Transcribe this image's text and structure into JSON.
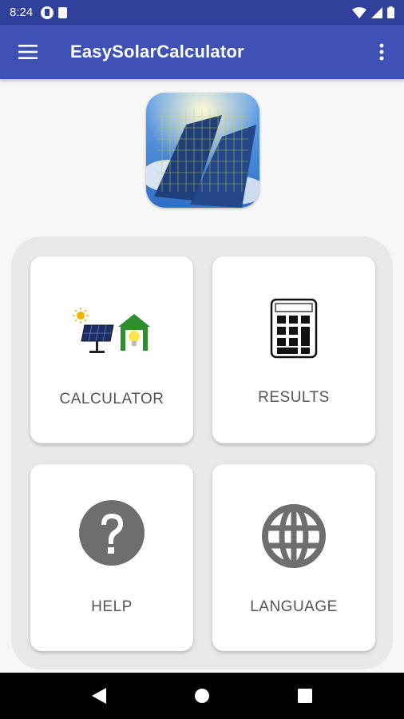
{
  "status_bar": {
    "time": "8:24"
  },
  "app_bar": {
    "title": "EasySolarCalculator"
  },
  "menu": {
    "cards": [
      {
        "label": "CALCULATOR",
        "icon": "solar-house-icon"
      },
      {
        "label": "RESULTS",
        "icon": "calculator-icon"
      },
      {
        "label": "HELP",
        "icon": "help-icon"
      },
      {
        "label": "LANGUAGE",
        "icon": "globe-icon"
      }
    ]
  },
  "colors": {
    "status_bar": "#2f3f9a",
    "app_bar": "#3f51b5",
    "panel": "#e8e8e8",
    "icon_gray": "#6e6e6e"
  }
}
